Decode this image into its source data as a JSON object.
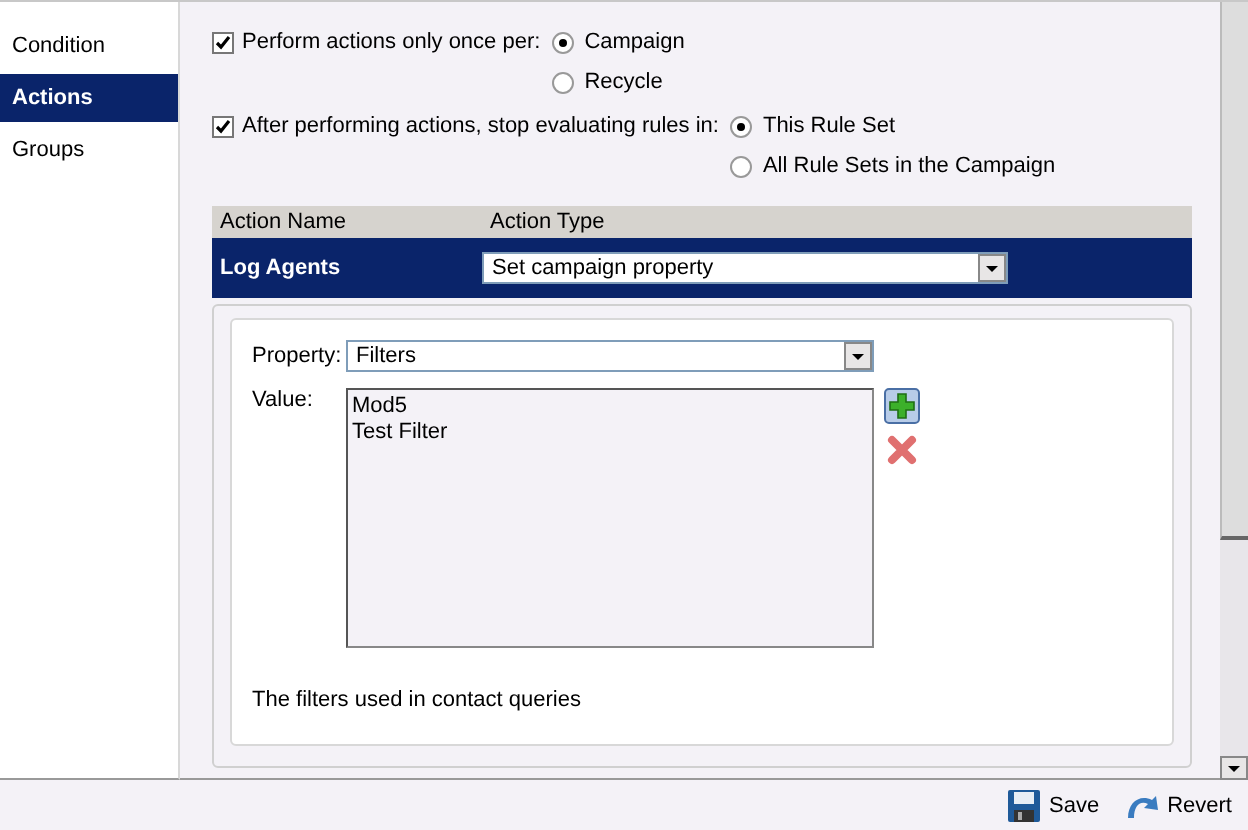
{
  "sidebar": {
    "items": [
      {
        "label": "Condition",
        "selected": false
      },
      {
        "label": "Actions",
        "selected": true
      },
      {
        "label": "Groups",
        "selected": false
      }
    ]
  },
  "options": [
    {
      "label": "Perform actions only once per:",
      "checked": true,
      "choices": [
        {
          "label": "Campaign",
          "selected": true
        },
        {
          "label": "Recycle",
          "selected": false
        }
      ]
    },
    {
      "label": "After performing actions, stop evaluating rules in:",
      "checked": true,
      "choices": [
        {
          "label": "This Rule Set",
          "selected": true
        },
        {
          "label": "All Rule Sets in the Campaign",
          "selected": false
        }
      ]
    }
  ],
  "actions_table": {
    "columns": [
      "Action Name",
      "Action Type"
    ],
    "rows": [
      {
        "name": "Log Agents",
        "type": "Set campaign property",
        "selected": true
      }
    ]
  },
  "property_editor": {
    "property_label": "Property:",
    "property": "Filters",
    "value_label": "Value:",
    "values": [
      "Mod5",
      "Test Filter"
    ],
    "description": "The filters used in contact queries"
  },
  "footer_buttons": [
    {
      "label": "Save",
      "kind": "save"
    },
    {
      "label": "Revert",
      "kind": "revert"
    }
  ]
}
